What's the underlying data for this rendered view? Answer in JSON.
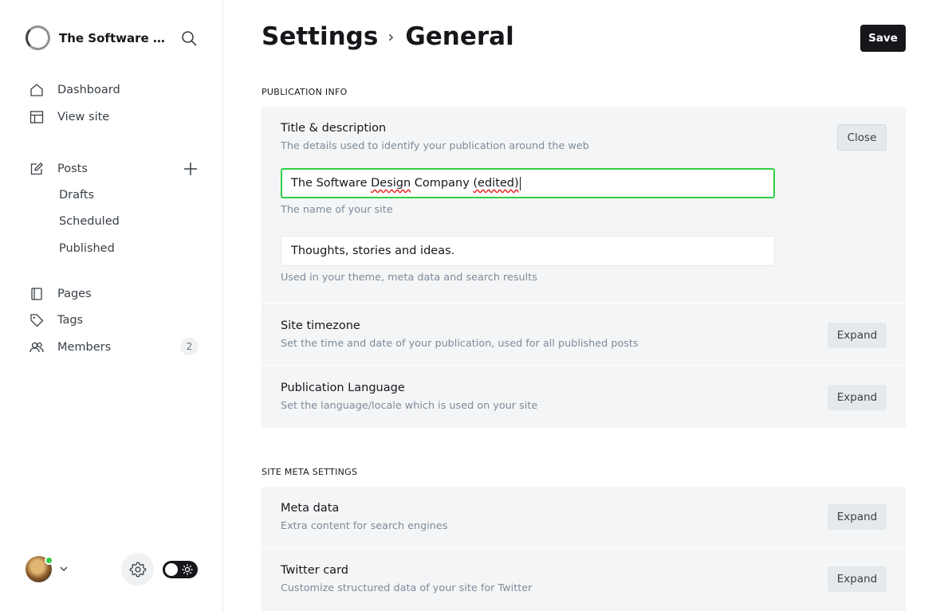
{
  "sidebar": {
    "brand_name": "The Software De...",
    "nav": {
      "dashboard": "Dashboard",
      "view_site": "View site",
      "posts": "Posts",
      "drafts": "Drafts",
      "scheduled": "Scheduled",
      "published": "Published",
      "pages": "Pages",
      "tags": "Tags",
      "members": "Members",
      "members_count": "2"
    }
  },
  "header": {
    "title_parent": "Settings",
    "breadcrumb_separator": "›",
    "title_current": "General",
    "save_label": "Save"
  },
  "sections": {
    "publication_info": {
      "label": "PUBLICATION INFO",
      "title_description": {
        "title": "Title & description",
        "description": "The details used to identify your publication around the web",
        "button": "Close",
        "site_title_value_prefix": "The Software ",
        "site_title_value_misspelled_1": "Design",
        "site_title_value_mid": " Company ",
        "site_title_value_misspelled_2": "(edited)",
        "site_title_help": "The name of your site",
        "site_description_value": "Thoughts, stories and ideas.",
        "site_description_help": "Used in your theme, meta data and search results"
      },
      "timezone": {
        "title": "Site timezone",
        "description": "Set the time and date of your publication, used for all published posts",
        "button": "Expand"
      },
      "language": {
        "title": "Publication Language",
        "description": "Set the language/locale which is used on your site",
        "button": "Expand"
      }
    },
    "site_meta": {
      "label": "SITE META SETTINGS",
      "meta_data": {
        "title": "Meta data",
        "description": "Extra content for search engines",
        "button": "Expand"
      },
      "twitter": {
        "title": "Twitter card",
        "description": "Customize structured data of your site for Twitter",
        "button": "Expand"
      }
    }
  },
  "colors": {
    "focus_border": "#30cf43",
    "online_dot": "#30cf43",
    "primary_button": "#15171a"
  }
}
